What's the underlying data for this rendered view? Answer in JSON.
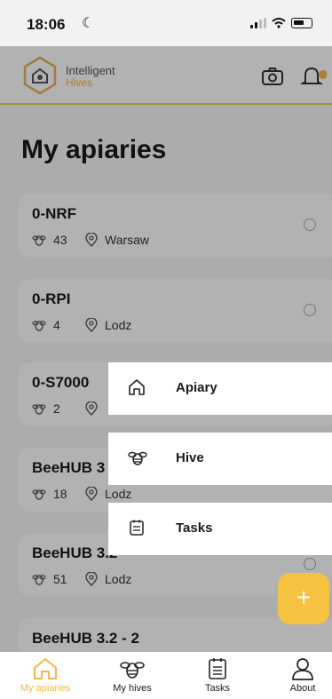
{
  "status_bar": {
    "time": "18:06"
  },
  "header": {
    "brand_line1": "Intelligent",
    "brand_line2": "Hives"
  },
  "page_title": "My apiaries",
  "apiaries": [
    {
      "name": "0-NRF",
      "hive_count": "43",
      "location": "Warsaw"
    },
    {
      "name": "0-RPI",
      "hive_count": "4",
      "location": "Lodz"
    },
    {
      "name": "0-S7000",
      "hive_count": "2",
      "location": ""
    },
    {
      "name": "BeeHUB 3",
      "hive_count": "18",
      "location": "Lodz"
    },
    {
      "name": "BeeHUB 3.2",
      "hive_count": "51",
      "location": "Lodz"
    },
    {
      "name": "BeeHUB 3.2 - 2",
      "hive_count": "",
      "location": ""
    }
  ],
  "add_menu": [
    {
      "label": "Apiary",
      "icon": "home-icon"
    },
    {
      "label": "Hive",
      "icon": "bee-icon"
    },
    {
      "label": "Tasks",
      "icon": "tasks-icon"
    }
  ],
  "fab": {
    "label": "+"
  },
  "bottom_nav": [
    {
      "label": "My apiaries",
      "icon": "home-icon",
      "active": true
    },
    {
      "label": "My hives",
      "icon": "bee-icon",
      "active": false
    },
    {
      "label": "Tasks",
      "icon": "tasks-icon",
      "active": false
    },
    {
      "label": "About",
      "icon": "user-icon",
      "active": false
    }
  ],
  "colors": {
    "accent": "#f2b84b",
    "fab": "#f6c241",
    "text": "#1a1a1a"
  }
}
